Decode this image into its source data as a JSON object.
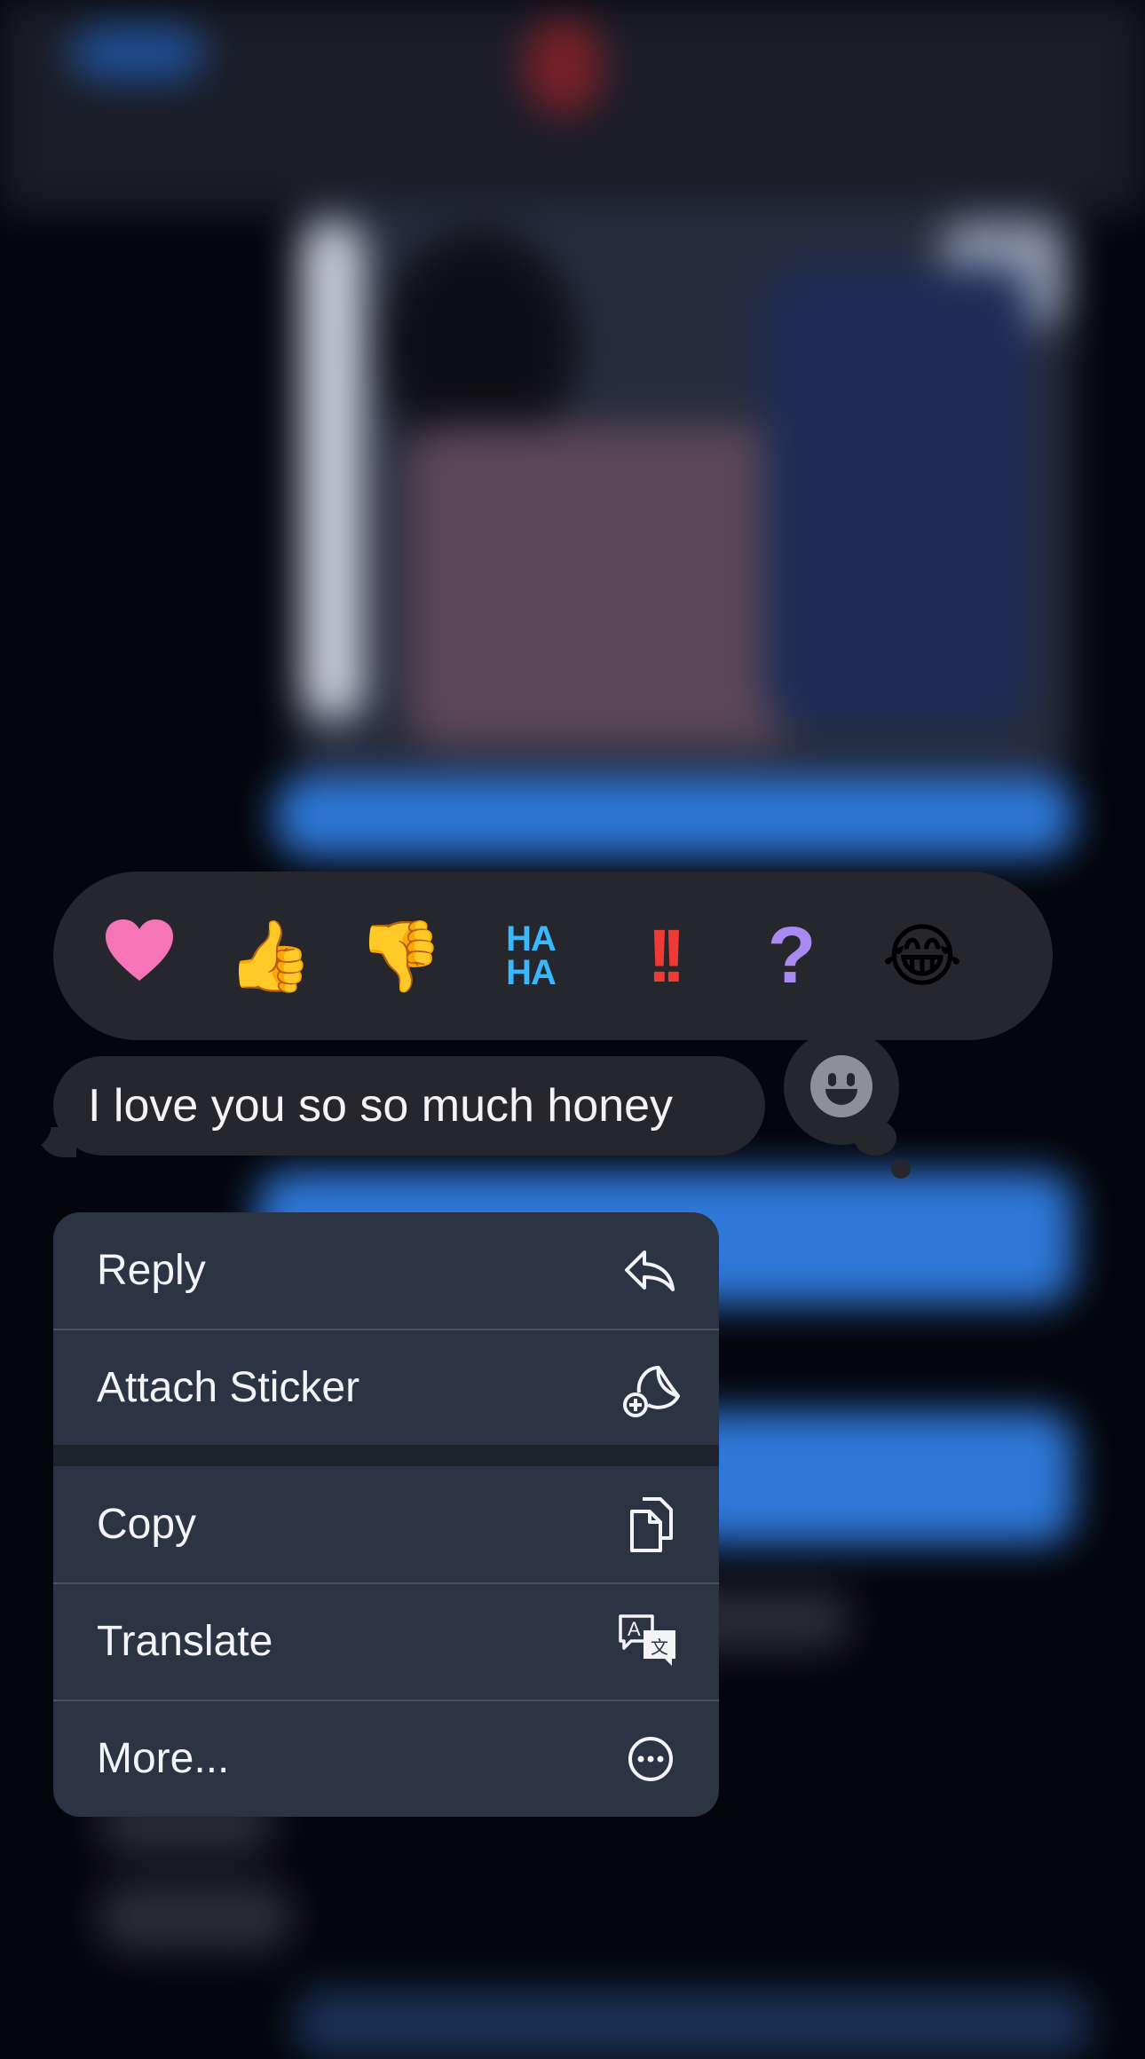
{
  "reactions": [
    {
      "name": "heart",
      "glyph": "❤️"
    },
    {
      "name": "thumbs-up",
      "glyph": "👍"
    },
    {
      "name": "thumbs-down",
      "glyph": "👎"
    },
    {
      "name": "haha",
      "line1": "HA",
      "line2": "HA"
    },
    {
      "name": "exclamation",
      "glyph": "!!"
    },
    {
      "name": "question",
      "glyph": "?"
    },
    {
      "name": "tears-of-joy",
      "glyph": "😂"
    }
  ],
  "message": {
    "text": "I love you so so much honey"
  },
  "menu": [
    {
      "label": "Reply",
      "icon": "reply-arrow-icon"
    },
    {
      "label": "Attach Sticker",
      "icon": "sticker-plus-icon"
    },
    {
      "label": "Copy",
      "icon": "copy-documents-icon"
    },
    {
      "label": "Translate",
      "icon": "translate-bubbles-icon"
    },
    {
      "label": "More...",
      "icon": "ellipsis-circle-icon"
    }
  ],
  "translate_icon_letters": {
    "latin": "A",
    "other": "文"
  },
  "colors": {
    "background": "#05060c",
    "reaction_bar": "#26272c",
    "menu_background": "#2c3444",
    "text": "#f4f4f6",
    "imessage_blue": "#2f78d8"
  }
}
